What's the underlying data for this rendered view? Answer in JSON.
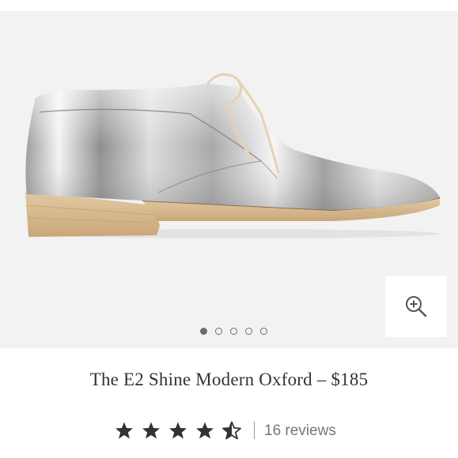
{
  "product": {
    "title": "The E2 Shine Modern Oxford – $185",
    "rating": 4.5,
    "rating_max": 5,
    "reviews_label": "16 reviews",
    "divider": "|"
  },
  "gallery": {
    "image_count": 5,
    "active_index": 0,
    "zoom_icon": "zoom-in-icon",
    "background_color": "#f2f2f2"
  },
  "colors": {
    "star_color": "#333333",
    "text_color": "#333333",
    "muted_text": "#777777"
  }
}
